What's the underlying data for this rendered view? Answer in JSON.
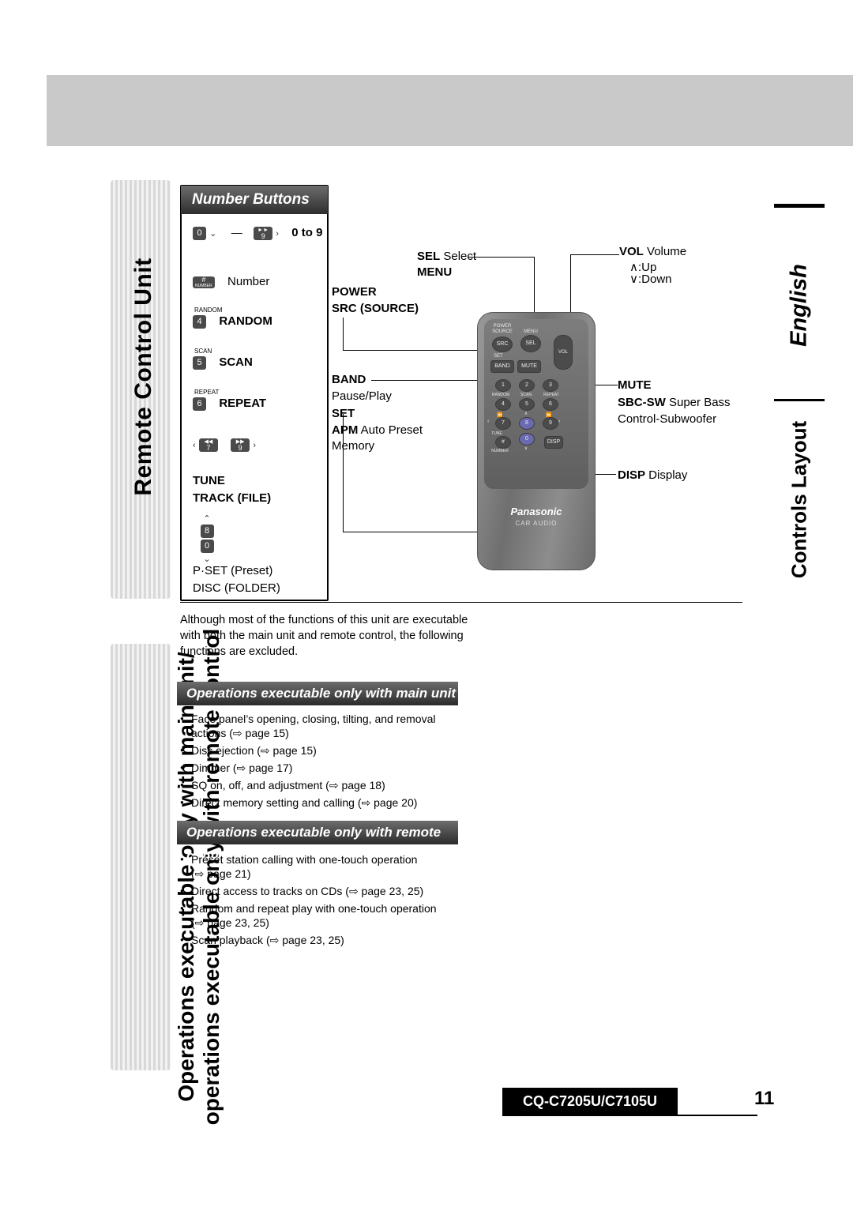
{
  "page": {
    "number": "11",
    "model": "CQ-C7205U/C7105U",
    "lang_tab": "English",
    "controls_tab": "Controls Layout"
  },
  "left_tabs": {
    "remote_control_unit": "Remote Control Unit",
    "ops_line1": "Operations executable only with main unit/",
    "ops_line2": "operations executable only with remote control"
  },
  "number_panel": {
    "title": "Number Buttons",
    "range_keys": {
      "from": "0",
      "to": "9"
    },
    "range_text": "0 to 9",
    "dash": "—",
    "rows": [
      {
        "key": "#",
        "sub": "NUMBER",
        "label": "Number"
      },
      {
        "key": "4",
        "sub": "RANDOM",
        "label": "RANDOM"
      },
      {
        "key": "5",
        "sub": "SCAN",
        "label": "SCAN"
      },
      {
        "key": "6",
        "sub": "REPEAT",
        "label": "REPEAT"
      },
      {
        "key": "7",
        "sub": "◀◀",
        "label": ""
      },
      {
        "key": "9",
        "sub": "▶▶",
        "label": ""
      }
    ],
    "tune_title": "TUNE",
    "track_title": "TRACK (FILE)",
    "vert_keys": {
      "up": "8",
      "down": "0"
    },
    "preset": "P·SET (Preset)",
    "disc": "DISC (FOLDER)"
  },
  "callouts": {
    "sel": {
      "bold": "SEL",
      "rest": " Select"
    },
    "menu": "MENU",
    "power": "POWER",
    "src": "SRC (SOURCE)",
    "band": "BAND",
    "band_sub": "Pause/Play",
    "set": "SET",
    "apm": {
      "bold": "APM",
      "rest": " Auto Preset"
    },
    "apm_sub": "Memory",
    "vol": {
      "bold": "VOL",
      "rest": " Volume"
    },
    "vol_up": "∧:Up",
    "vol_down": "∨:Down",
    "mute": "MUTE",
    "sbcsw": {
      "bold": "SBC-SW",
      "rest": " Super Bass"
    },
    "sbcsw_sub": "Control-Subwoofer",
    "disp": {
      "bold": "DISP",
      "rest": " Display"
    }
  },
  "remote": {
    "brand": "Panasonic",
    "brand_sub": "CAR AUDIO",
    "labels": {
      "power": "POWER",
      "source": "SOURCE",
      "menu": "MENU",
      "src": "SRC",
      "sel": "SEL",
      "set": "SET",
      "band": "BAND",
      "mute": "MUTE",
      "vol": "VOL",
      "random": "RANDOM",
      "scan": "SCAN",
      "repeat": "REPEAT",
      "tune": "TUNE",
      "number": "NUMBER",
      "disp": "DISP",
      "num1": "1",
      "num2": "2",
      "num3": "3",
      "num4": "4",
      "num5": "5",
      "num6": "6",
      "num7": "7",
      "num8": "8",
      "num9": "9",
      "num0": "0",
      "hash": "#",
      "rew": "⏪",
      "ffw": "⏩",
      "up": "∧",
      "down": "∨",
      "left": "‹",
      "right": "›"
    }
  },
  "intro": "Although most of the functions of this unit are executable with both the main unit and remote control, the following functions are excluded.",
  "section_main": {
    "title": "Operations executable only with main unit",
    "items": [
      "Face panel’s opening, closing, tilting, and removal",
      "actions (⇨ page 15)",
      "Disc ejection (⇨ page 15)",
      "Dimmer (⇨ page 17)",
      "SQ on, off, and adjustment (⇨ page 18)",
      "Direct memory setting and calling (⇨ page 20)"
    ]
  },
  "section_remote": {
    "title": "Operations executable only with remote control",
    "items": [
      "Preset station calling with one-touch operation",
      "(⇨ page 21)",
      "Direct access to tracks on CDs (⇨ page 23, 25)",
      "Random and repeat play with one-touch operation",
      "(⇨ page 23, 25)",
      "Scan playback (⇨ page 23, 25)"
    ]
  }
}
